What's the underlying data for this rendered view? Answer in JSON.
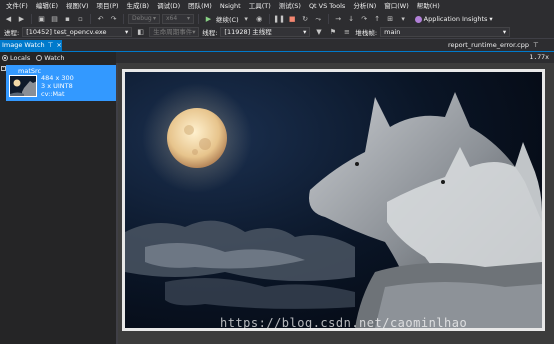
{
  "menu": [
    "文件(F)",
    "编辑(E)",
    "视图(V)",
    "项目(P)",
    "生成(B)",
    "调试(D)",
    "团队(M)",
    "Nsight",
    "工具(T)",
    "测试(S)",
    "Qt VS Tools",
    "分析(N)",
    "窗口(W)",
    "帮助(H)"
  ],
  "toolbar": {
    "config": "Debug",
    "platform": "x64",
    "continue_label": "继续(C)",
    "app_insights_label": "Application Insights"
  },
  "debugbar": {
    "process_label": "进程:",
    "process_value": "[10452] test_opencv.exe",
    "lifecycle_label": "生命周期事件",
    "thread_label": "线程:",
    "thread_value": "[11928] 主线程",
    "stack_label": "堆栈帧:",
    "stack_value": "main"
  },
  "tabs": {
    "active_label": "Image Watch",
    "pin_icon": "⊤",
    "close_icon": "×",
    "file_tab": "report_runtime_error.cpp",
    "file_pin": "⊤"
  },
  "radios": {
    "locals_label": "Locals",
    "watch_label": "Watch",
    "selected": "Locals"
  },
  "variable": {
    "name": "matSrc",
    "size": "484 x 300",
    "channels": "3 x UINT8",
    "type": "cv::Mat"
  },
  "zoom": "1.77x",
  "watermark": "https://blog.csdn.net/caominlhao",
  "colors": {
    "accent": "#007acc",
    "selection": "#3399ff",
    "background": "#2d2d30",
    "panel": "#252526"
  }
}
